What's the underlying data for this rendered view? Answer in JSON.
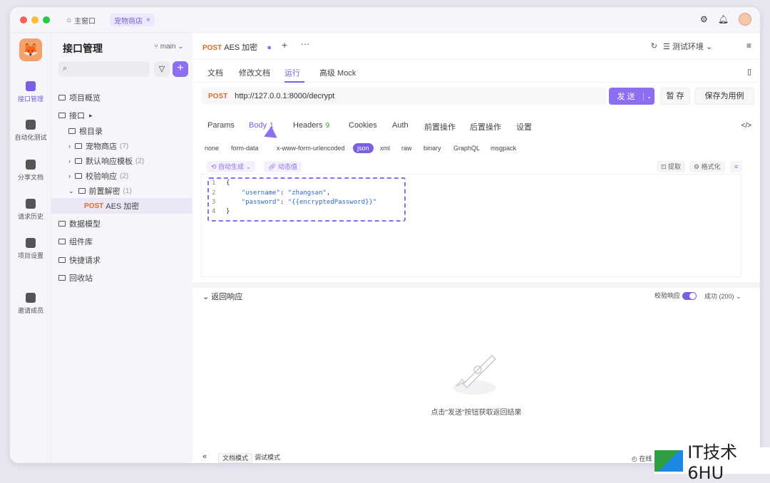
{
  "titlebar": {
    "home_tab": "主窗口",
    "shop_tab": "宠物商店",
    "close": "×"
  },
  "rail": {
    "logo": "🦊",
    "items": [
      {
        "label": "接口管理",
        "icon": "api-icon"
      },
      {
        "label": "自动化测试",
        "icon": "automation-icon"
      },
      {
        "label": "分享文档",
        "icon": "share-doc-icon"
      },
      {
        "label": "请求历史",
        "icon": "history-icon"
      },
      {
        "label": "项目设置",
        "icon": "settings-icon"
      },
      {
        "label": "邀请成员",
        "icon": "invite-icon"
      }
    ]
  },
  "sidebar": {
    "title": "接口管理",
    "branch": "main",
    "overview": "项目概览",
    "api_root": "接口",
    "root_dir": "根目录",
    "folders": [
      {
        "name": "宠物商店",
        "count": "(7)"
      },
      {
        "name": "默认响应模板",
        "count": "(2)"
      },
      {
        "name": "校验响应",
        "count": "(2)"
      },
      {
        "name": "前置解密",
        "count": "(1)"
      }
    ],
    "selected": {
      "method": "POST",
      "name": "AES 加密"
    },
    "sections": [
      "数据模型",
      "组件库",
      "快捷请求",
      "回收站"
    ]
  },
  "main": {
    "doc_method": "POST",
    "doc_name": "AES 加密",
    "env": "测试环境",
    "subtabs": [
      "文档",
      "修改文档",
      "运行",
      "高级 Mock"
    ],
    "url_method": "POST",
    "url": "http://127.0.0.1:8000/decrypt",
    "send": "发 送",
    "save_temp": "暂 存",
    "save_case": "保存为用例",
    "req_tabs": {
      "params": "Params",
      "body": "Body",
      "body_count": "1",
      "headers": "Headers",
      "headers_count": "9",
      "cookies": "Cookies",
      "auth": "Auth",
      "pre": "前置操作",
      "post": "后置操作",
      "settings": "设置"
    },
    "body_types": [
      "none",
      "form-data",
      "x-www-form-urlencoded",
      "json",
      "xml",
      "raw",
      "binary",
      "GraphQL",
      "msgpack"
    ],
    "auto_gen": "自动生成",
    "dyn_value": "动态值",
    "extract": "提取",
    "format": "格式化",
    "code": {
      "l1": "{",
      "l2_key": "\"username\"",
      "l2_val": "\"zhangsan\"",
      "l3_key": "\"password\"",
      "l3_val": "\"{{encryptedPassword}}\"",
      "l4": "}"
    },
    "resp_title": "返回响应",
    "validate": "校验响应",
    "status": "成功 (200)",
    "empty": "点击\"发送\"按钮获取返回结果",
    "doc_mode": "文档模式",
    "debug_mode": "调试模式",
    "online": "在线"
  },
  "watermark": "IT技术6HU"
}
